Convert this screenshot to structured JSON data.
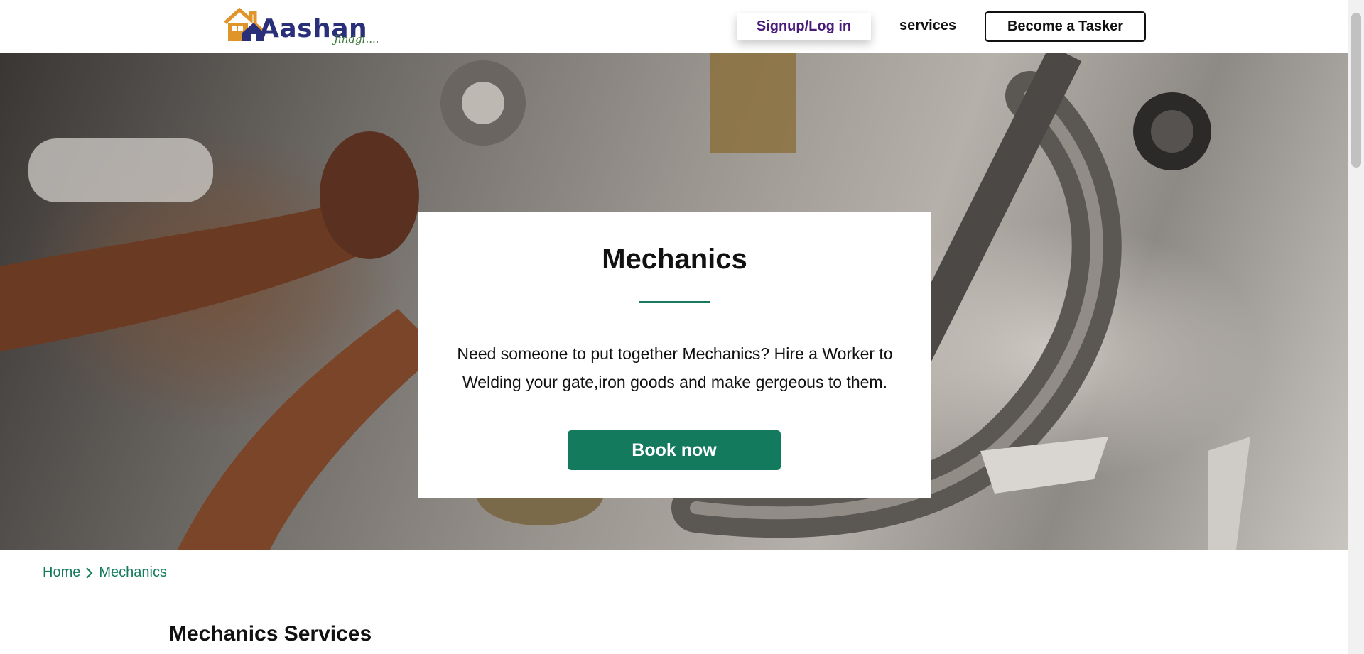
{
  "brand": {
    "name": "Aashan",
    "tagline": "Jindgi...."
  },
  "nav": {
    "signup_label": "Signup/Log in",
    "services_label": "services",
    "tasker_label": "Become a Tasker"
  },
  "hero": {
    "title": "Mechanics",
    "description": "Need someone to put together Mechanics? Hire a Worker to Welding your gate,iron goods and make gergeous to them.",
    "cta_label": "Book now"
  },
  "breadcrumb": {
    "home": "Home",
    "current": "Mechanics"
  },
  "section": {
    "title": "Mechanics Services"
  },
  "colors": {
    "accent": "#137a5e",
    "signup_text": "#4a1a78",
    "brand_text": "#2a2f7a"
  }
}
